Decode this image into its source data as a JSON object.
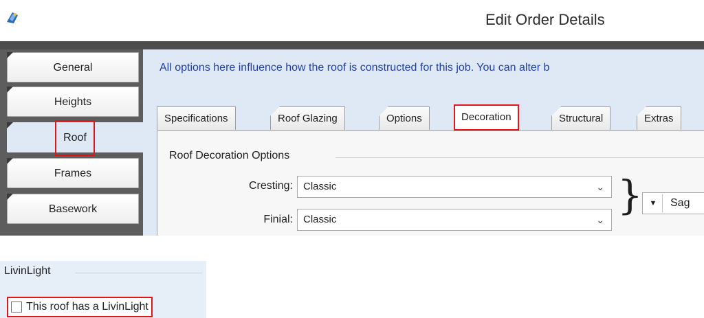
{
  "window": {
    "title": "Edit Order Details"
  },
  "sidebar": {
    "items": [
      {
        "label": "General"
      },
      {
        "label": "Heights"
      },
      {
        "label": "Roof"
      },
      {
        "label": "Frames"
      },
      {
        "label": "Basework"
      }
    ],
    "selected": "Roof"
  },
  "main": {
    "info_text": "All options here influence how the roof is constructed for this job. You can alter b",
    "tabs": [
      {
        "label": "Specifications"
      },
      {
        "label": "Roof Glazing"
      },
      {
        "label": "Options"
      },
      {
        "label": "Decoration"
      },
      {
        "label": "Structural"
      },
      {
        "label": "Extras"
      }
    ],
    "active_tab": "Decoration",
    "group_title": "Roof Decoration Options",
    "fields": [
      {
        "label": "Cresting:",
        "value": "Classic"
      },
      {
        "label": "Finial:",
        "value": "Classic"
      }
    ],
    "brace": "}",
    "side_dropdown": {
      "value": "Sag"
    }
  },
  "livinlight": {
    "group_title": "LivinLight",
    "checkbox_label": "This roof has a LivinLight",
    "checked": false
  },
  "colors": {
    "highlight_red": "#e0161b",
    "accent_blue": "#1f3fa6",
    "panel_blue": "#dfe9f6"
  }
}
